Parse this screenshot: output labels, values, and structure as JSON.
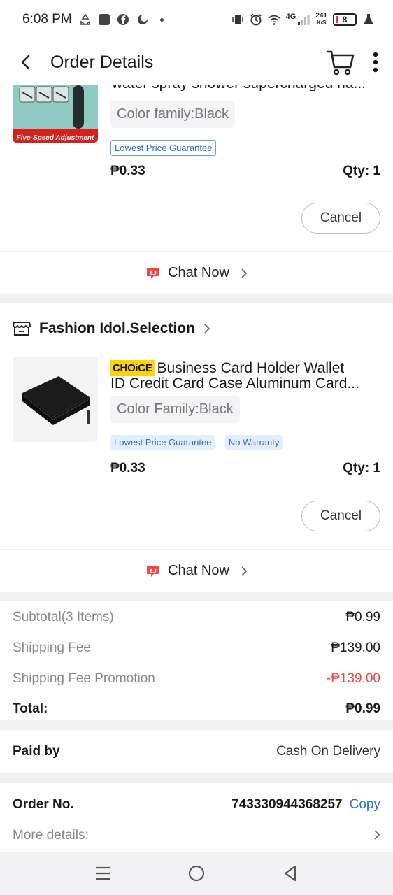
{
  "status_bar": {
    "time": "6:08 PM",
    "network": "4G",
    "speed_value": "241",
    "speed_unit": "K/S",
    "battery": "8"
  },
  "header": {
    "title": "Order Details",
    "icons": [
      "back-arrow-icon",
      "cart-icon",
      "more-vertical-icon"
    ]
  },
  "item1": {
    "title_line": "water spray shower supercharged ha...",
    "thumb_caption": "Five-Speed Adjustment",
    "variant": "Color family:Black",
    "tags": [
      "Lowest Price Guarantee"
    ],
    "price": "₱0.33",
    "qty": "Qty: 1",
    "cancel_label": "Cancel",
    "chat_label": "Chat Now"
  },
  "store2": {
    "name": "Fashion Idol.Selection"
  },
  "item2": {
    "badge": "CHOiCE",
    "title_line1": "Business Card Holder Wallet",
    "title_line2": "ID Credit Card Case Aluminum Card...",
    "variant": "Color Family:Black",
    "tags": [
      "Lowest Price Guarantee",
      "No Warranty"
    ],
    "price": "₱0.33",
    "qty": "Qty: 1",
    "cancel_label": "Cancel",
    "chat_label": "Chat Now"
  },
  "summary": {
    "subtotal_label": "Subtotal(3 Items)",
    "subtotal_value": "₱0.99",
    "shipping_label": "Shipping Fee",
    "shipping_value": "₱139.00",
    "promo_label": "Shipping Fee Promotion",
    "promo_value": "-₱139.00",
    "total_label": "Total:",
    "total_value": "₱0.99"
  },
  "payment": {
    "label": "Paid by",
    "value": "Cash On Delivery"
  },
  "order": {
    "label": "Order No.",
    "number": "743330944368257",
    "copy_label": "Copy",
    "more_label": "More details:"
  },
  "colors": {
    "accent_blue": "#2d6fd1",
    "promo_red": "#e44848",
    "chat_red": "#f04848",
    "choice_yellow": "#ffd400"
  }
}
